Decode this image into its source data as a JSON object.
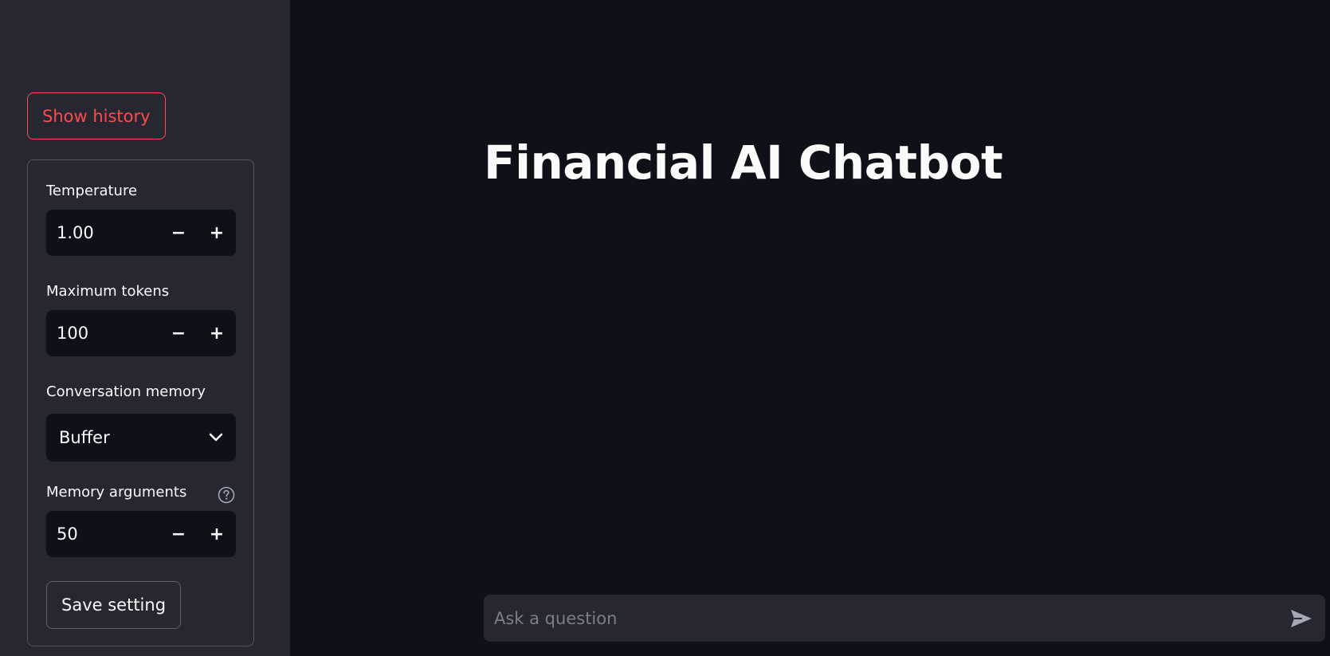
{
  "sidebar": {
    "history_button": "Show history",
    "settings": {
      "temperature": {
        "label": "Temperature",
        "value": "1.00"
      },
      "max_tokens": {
        "label": "Maximum tokens",
        "value": "100"
      },
      "memory": {
        "label": "Conversation memory",
        "selected": "Buffer"
      },
      "memory_args": {
        "label": "Memory arguments",
        "value": "50"
      },
      "decrement_symbol": "−",
      "increment_symbol": "+",
      "save_button": "Save setting"
    }
  },
  "main": {
    "title": "Financial AI Chatbot",
    "chat_placeholder": "Ask a question"
  },
  "colors": {
    "app_background": "#0e1117",
    "sidebar_background": "#262730",
    "accent": "#ff4b4b",
    "text": "#fafafa"
  },
  "icons": [
    "chevron-down-icon",
    "help-circle-icon",
    "send-icon"
  ]
}
